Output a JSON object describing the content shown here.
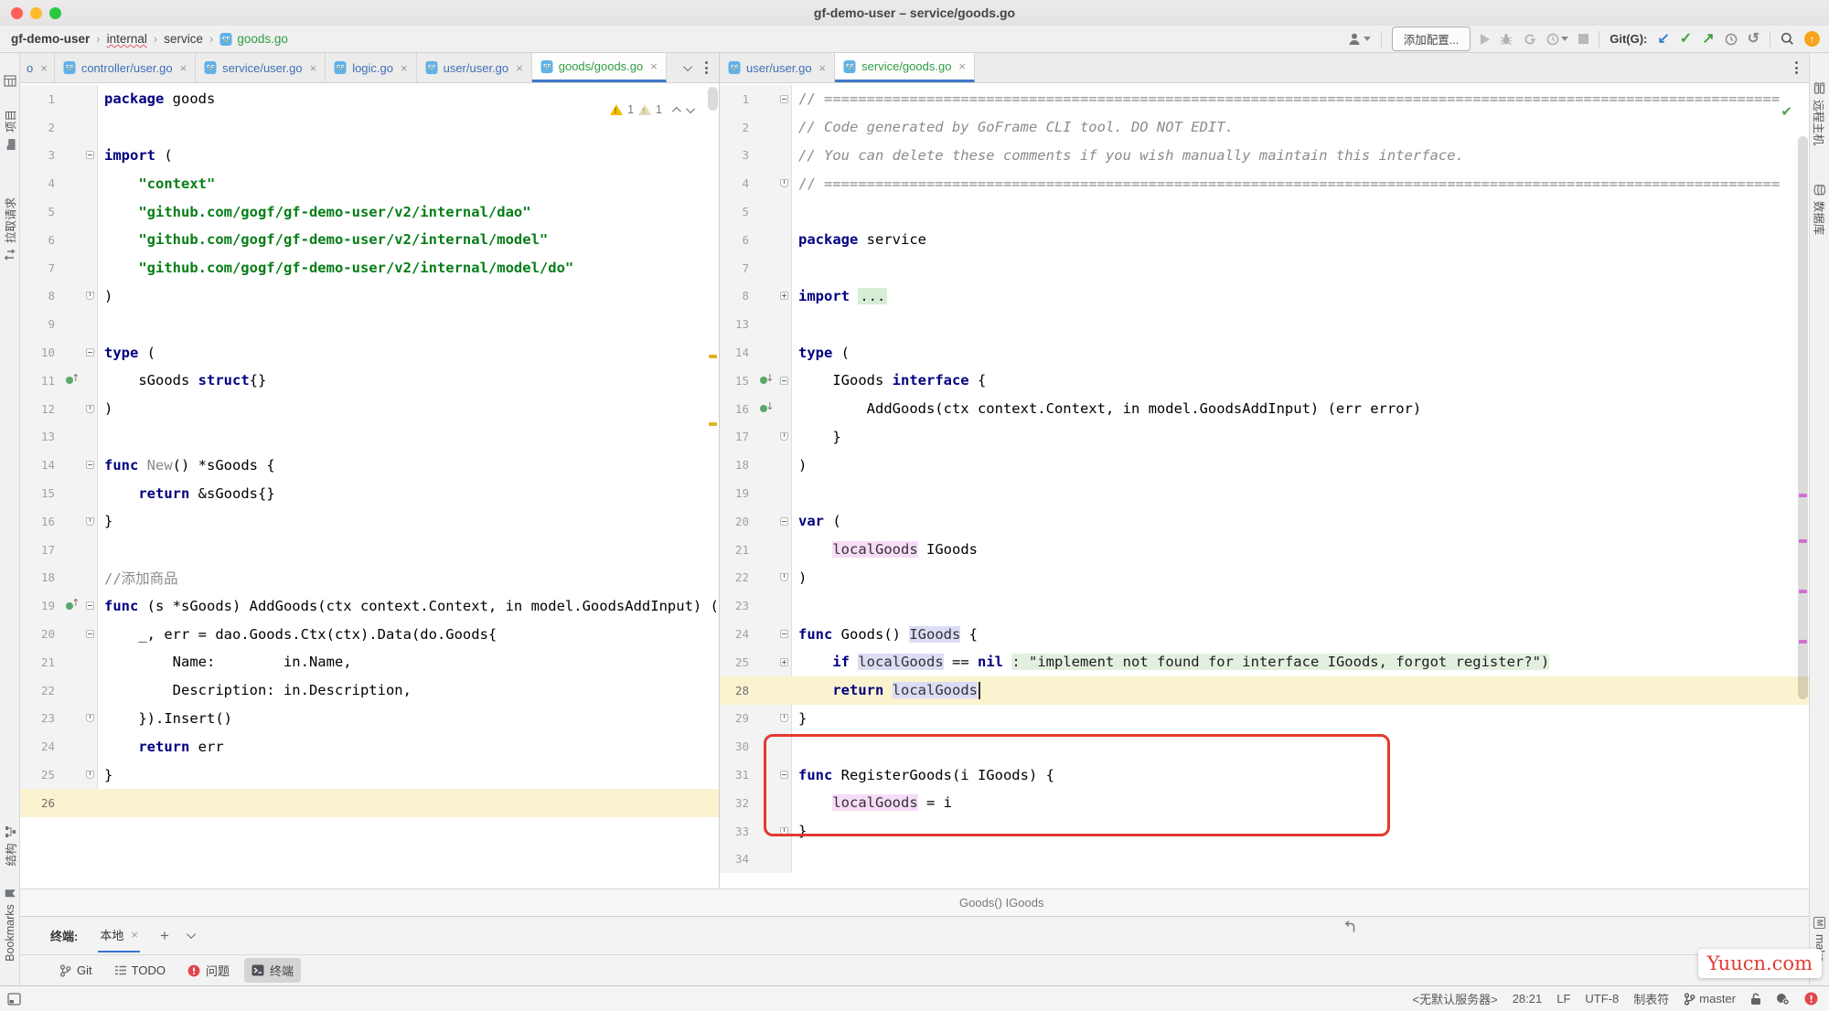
{
  "window": {
    "title": "gf-demo-user – service/goods.go"
  },
  "breadcrumbs": {
    "root": "gf-demo-user",
    "items": [
      "internal",
      "service"
    ],
    "file": "goods.go",
    "separator": "›"
  },
  "toolbar": {
    "config_button": "添加配置...",
    "git_label": "Git(G):"
  },
  "colors": {
    "accent_blue": "#3e78c9",
    "vcs_added_green": "#2f9e44",
    "vcs_modified_blue": "#3f6fb5",
    "error_red": "#e0474c",
    "warning_yellow": "#f0c000",
    "annotation_red": "#e33a30",
    "current_line": "#fbf2d0",
    "string_green": "#067d17",
    "keyword_navy": "#000080"
  },
  "left_tabbar": {
    "tabs": [
      {
        "label": "o",
        "color": "blue",
        "partial": true
      },
      {
        "label": "controller/user.go",
        "color": "blue"
      },
      {
        "label": "service/user.go",
        "color": "blue"
      },
      {
        "label": "logic.go",
        "color": "blue"
      },
      {
        "label": "user/user.go",
        "color": "blue"
      },
      {
        "label": "goods/goods.go",
        "color": "green",
        "active": true
      }
    ]
  },
  "right_tabbar": {
    "tabs": [
      {
        "label": "user/user.go",
        "color": "blue"
      },
      {
        "label": "service/goods.go",
        "color": "green",
        "active": true
      }
    ]
  },
  "left_editor": {
    "warning_count": "1",
    "weak_warning_count": "1",
    "lines": [
      {
        "n": 1,
        "t": [
          [
            "kw",
            "package"
          ],
          [
            "pl",
            " goods"
          ]
        ]
      },
      {
        "n": 2,
        "t": []
      },
      {
        "n": 3,
        "t": [
          [
            "kw",
            "import"
          ],
          [
            "pl",
            " ("
          ]
        ],
        "fold": "open"
      },
      {
        "n": 4,
        "t": [
          [
            "pl",
            "    "
          ],
          [
            "str",
            "\"context\""
          ]
        ]
      },
      {
        "n": 5,
        "t": [
          [
            "pl",
            "    "
          ],
          [
            "str",
            "\"github.com/gogf/gf-demo-user/v2/internal/dao\""
          ]
        ]
      },
      {
        "n": 6,
        "t": [
          [
            "pl",
            "    "
          ],
          [
            "str",
            "\"github.com/gogf/gf-demo-user/v2/internal/model\""
          ]
        ]
      },
      {
        "n": 7,
        "t": [
          [
            "pl",
            "    "
          ],
          [
            "str",
            "\"github.com/gogf/gf-demo-user/v2/internal/model/do\""
          ]
        ]
      },
      {
        "n": 8,
        "t": [
          [
            "pl",
            ")"
          ]
        ],
        "fold": "end"
      },
      {
        "n": 9,
        "t": []
      },
      {
        "n": 10,
        "t": [
          [
            "kw",
            "type"
          ],
          [
            "pl",
            " ("
          ]
        ],
        "fold": "open"
      },
      {
        "n": 11,
        "t": [
          [
            "pl",
            "    sGoods "
          ],
          [
            "kw",
            "struct"
          ],
          [
            "pl",
            "{}"
          ]
        ],
        "icon": "up"
      },
      {
        "n": 12,
        "t": [
          [
            "pl",
            ")"
          ]
        ],
        "fold": "end"
      },
      {
        "n": 13,
        "t": []
      },
      {
        "n": 14,
        "t": [
          [
            "kw",
            "func"
          ],
          [
            "pl",
            " "
          ],
          [
            "dim",
            "New"
          ],
          [
            "pl",
            "() *sGoods {"
          ]
        ],
        "fold": "open"
      },
      {
        "n": 15,
        "t": [
          [
            "pl",
            "    "
          ],
          [
            "kw",
            "return"
          ],
          [
            "pl",
            " &sGoods{}"
          ]
        ]
      },
      {
        "n": 16,
        "t": [
          [
            "pl",
            "}"
          ]
        ],
        "fold": "end"
      },
      {
        "n": 17,
        "t": []
      },
      {
        "n": 18,
        "t": [
          [
            "com",
            "//添加商品"
          ]
        ]
      },
      {
        "n": 19,
        "t": [
          [
            "kw",
            "func"
          ],
          [
            "pl",
            " (s *sGoods) AddGoods(ctx context.Context, in model.GoodsAddInput) (err error) {"
          ]
        ],
        "icon": "up",
        "fold": "open"
      },
      {
        "n": 20,
        "t": [
          [
            "pl",
            "    _, err = dao.Goods.Ctx(ctx).Data(do.Goods{"
          ]
        ],
        "fold": "open"
      },
      {
        "n": 21,
        "t": [
          [
            "pl",
            "        Name:        in.Name,"
          ]
        ]
      },
      {
        "n": 22,
        "t": [
          [
            "pl",
            "        Description: in.Description,"
          ]
        ]
      },
      {
        "n": 23,
        "t": [
          [
            "pl",
            "    }).Insert()"
          ]
        ],
        "fold": "end"
      },
      {
        "n": 24,
        "t": [
          [
            "pl",
            "    "
          ],
          [
            "kw",
            "return"
          ],
          [
            "pl",
            " err"
          ]
        ]
      },
      {
        "n": 25,
        "t": [
          [
            "pl",
            "}"
          ]
        ],
        "fold": "end"
      },
      {
        "n": 26,
        "t": [],
        "cur": true
      }
    ]
  },
  "right_editor": {
    "breadcrumb": "Goods() IGoods",
    "lines": [
      {
        "n": 1,
        "t": [
          [
            "com",
            "// ================================================================================================================"
          ]
        ],
        "fold": "open"
      },
      {
        "n": 2,
        "t": [
          [
            "comi",
            "// Code generated by GoFrame CLI tool. DO NOT EDIT."
          ]
        ]
      },
      {
        "n": 3,
        "t": [
          [
            "comi",
            "// You can delete these comments if you wish manually maintain this interface."
          ]
        ]
      },
      {
        "n": 4,
        "t": [
          [
            "com",
            "// ================================================================================================================"
          ]
        ],
        "fold": "end"
      },
      {
        "n": 5,
        "t": []
      },
      {
        "n": 6,
        "t": [
          [
            "kw",
            "package"
          ],
          [
            "pl",
            " service"
          ]
        ]
      },
      {
        "n": 7,
        "t": []
      },
      {
        "n": 8,
        "t": [
          [
            "kw",
            "import"
          ],
          [
            "pl",
            " "
          ],
          [
            "fell",
            "..."
          ]
        ],
        "fold": "closed"
      },
      {
        "n": 13,
        "t": []
      },
      {
        "n": 14,
        "t": [
          [
            "kw",
            "type"
          ],
          [
            "pl",
            " ("
          ]
        ]
      },
      {
        "n": 15,
        "t": [
          [
            "pl",
            "    IGoods "
          ],
          [
            "kw",
            "interface"
          ],
          [
            "pl",
            " {"
          ]
        ],
        "icon": "down",
        "fold": "open"
      },
      {
        "n": 16,
        "t": [
          [
            "pl",
            "        AddGoods(ctx context.Context, in model.GoodsAddInput) (err error)"
          ]
        ],
        "icon": "down"
      },
      {
        "n": 17,
        "t": [
          [
            "pl",
            "    }"
          ]
        ],
        "fold": "end"
      },
      {
        "n": 18,
        "t": [
          [
            "pl",
            ")"
          ]
        ]
      },
      {
        "n": 19,
        "t": []
      },
      {
        "n": 20,
        "t": [
          [
            "kw",
            "var"
          ],
          [
            "pl",
            " ("
          ]
        ],
        "fold": "open"
      },
      {
        "n": 21,
        "t": [
          [
            "pl",
            "    "
          ],
          [
            "hlp",
            "localGoods"
          ],
          [
            "pl",
            " IGoods"
          ]
        ]
      },
      {
        "n": 22,
        "t": [
          [
            "pl",
            ")"
          ]
        ],
        "fold": "end"
      },
      {
        "n": 23,
        "t": []
      },
      {
        "n": 24,
        "t": [
          [
            "kw",
            "func"
          ],
          [
            "pl",
            " Goods() "
          ],
          [
            "hlb",
            "IGoods"
          ],
          [
            "pl",
            " {"
          ]
        ],
        "fold": "open"
      },
      {
        "n": 25,
        "t": [
          [
            "pl",
            "    "
          ],
          [
            "kw",
            "if"
          ],
          [
            "pl",
            " "
          ],
          [
            "hlb",
            "localGoods"
          ],
          [
            "pl",
            " == "
          ],
          [
            "kw",
            "nil"
          ],
          [
            "pl",
            " "
          ],
          [
            "fold",
            ": \"implement not found for interface IGoods, forgot register?\")"
          ]
        ],
        "fold": "closed"
      },
      {
        "n": 28,
        "t": [
          [
            "pl",
            "    "
          ],
          [
            "kw",
            "return"
          ],
          [
            "pl",
            " "
          ],
          [
            "hlb",
            "localGoods"
          ],
          [
            "caret",
            ""
          ]
        ],
        "cur": true
      },
      {
        "n": 29,
        "t": [
          [
            "pl",
            "}"
          ]
        ],
        "fold": "end"
      },
      {
        "n": 30,
        "t": []
      },
      {
        "n": 31,
        "t": [
          [
            "kw",
            "func"
          ],
          [
            "pl",
            " RegisterGoods(i IGoods) {"
          ]
        ],
        "fold": "open"
      },
      {
        "n": 32,
        "t": [
          [
            "pl",
            "    "
          ],
          [
            "hlp",
            "localGoods"
          ],
          [
            "pl",
            " = i"
          ]
        ]
      },
      {
        "n": 33,
        "t": [
          [
            "pl",
            "}"
          ]
        ],
        "fold": "end"
      },
      {
        "n": 34,
        "t": []
      }
    ]
  },
  "left_stripe": {
    "top": [
      {
        "label": "项目"
      },
      {
        "label": "拉取请求"
      }
    ],
    "bottom": [
      {
        "label": "结构"
      },
      {
        "label": "Bookmarks"
      }
    ]
  },
  "right_stripe": {
    "top": [
      {
        "label": "远程主机"
      },
      {
        "label": "数据库"
      }
    ],
    "bottom": [
      {
        "label": "make..."
      }
    ]
  },
  "terminal": {
    "label": "终端:",
    "tab": "本地",
    "new_session": "+"
  },
  "toolwindow_bar": {
    "items": [
      "Git",
      "TODO",
      "问题",
      "终端"
    ]
  },
  "status_bar": {
    "server": "<无默认服务器>",
    "position": "28:21",
    "line_ending": "LF",
    "encoding": "UTF-8",
    "indent": "制表符",
    "branch": "master"
  },
  "watermark": "Yuucn.com"
}
